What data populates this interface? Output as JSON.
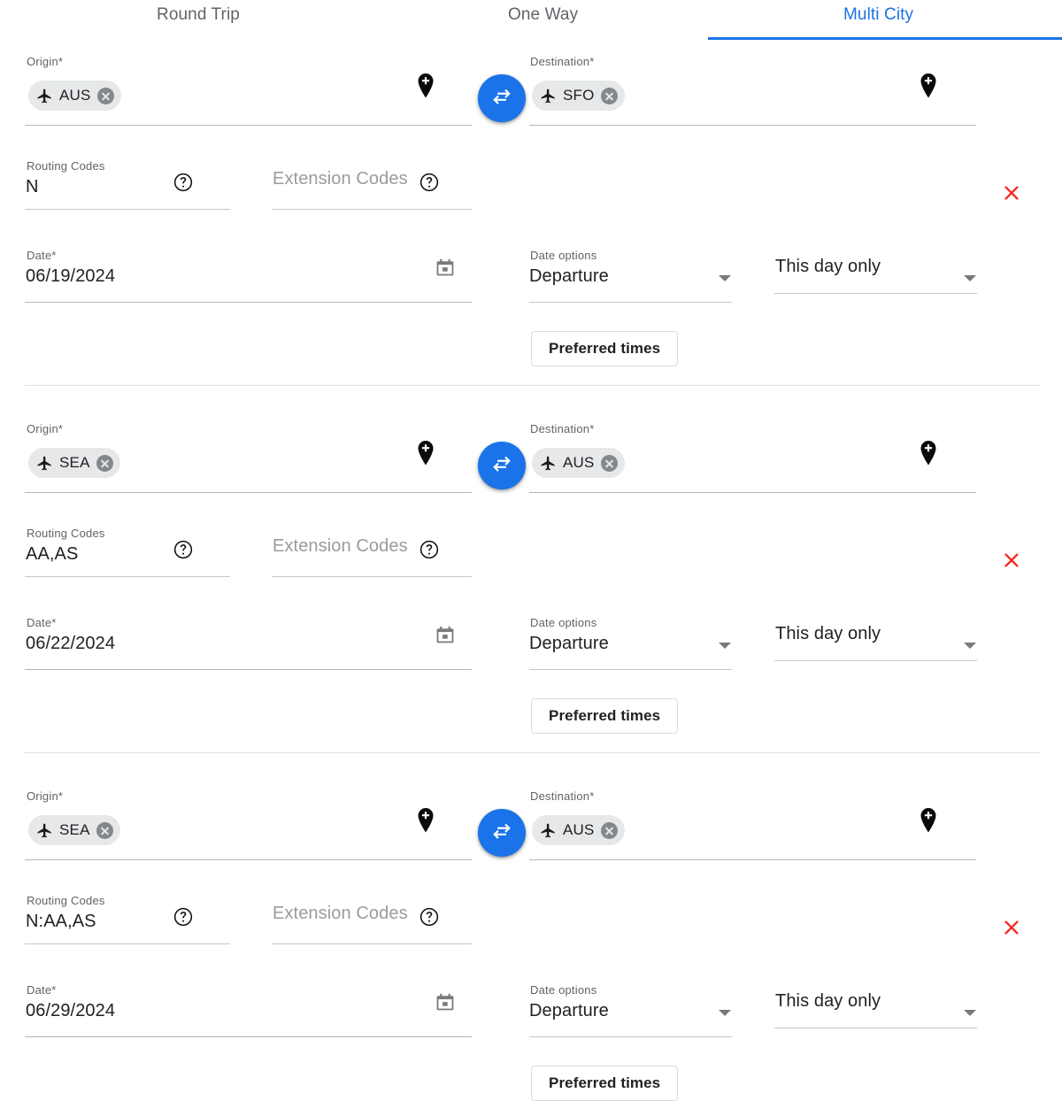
{
  "tabs": [
    {
      "label": "Round Trip",
      "active": false
    },
    {
      "label": "One Way",
      "active": false
    },
    {
      "label": "Multi City",
      "active": true
    }
  ],
  "accent_color": "#1a73e8",
  "delete_color": "#f4291f",
  "labels": {
    "origin": "Origin*",
    "destination": "Destination*",
    "routing_codes": "Routing Codes",
    "extension_codes_placeholder": "Extension Codes",
    "date": "Date*",
    "date_options": "Date options",
    "preferred_times": "Preferred times"
  },
  "icons": {
    "plane": "airplane-icon",
    "pin": "add-location-pin-icon",
    "swap": "swap-horizontal-icon",
    "help": "help-circle-icon",
    "calendar": "calendar-icon",
    "caret": "chevron-down-icon",
    "delete": "close-x-icon",
    "chip_remove": "chip-remove-icon"
  },
  "segments": [
    {
      "origin": "AUS",
      "destination": "SFO",
      "routing_codes": "N",
      "extension_codes": "",
      "date": "06/19/2024",
      "date_option": "Departure",
      "day_option": "This day only"
    },
    {
      "origin": "SEA",
      "destination": "AUS",
      "routing_codes": "AA,AS",
      "extension_codes": "",
      "date": "06/22/2024",
      "date_option": "Departure",
      "day_option": "This day only"
    },
    {
      "origin": "SEA",
      "destination": "AUS",
      "routing_codes": "N:AA,AS",
      "extension_codes": "",
      "date": "06/29/2024",
      "date_option": "Departure",
      "day_option": "This day only"
    }
  ]
}
